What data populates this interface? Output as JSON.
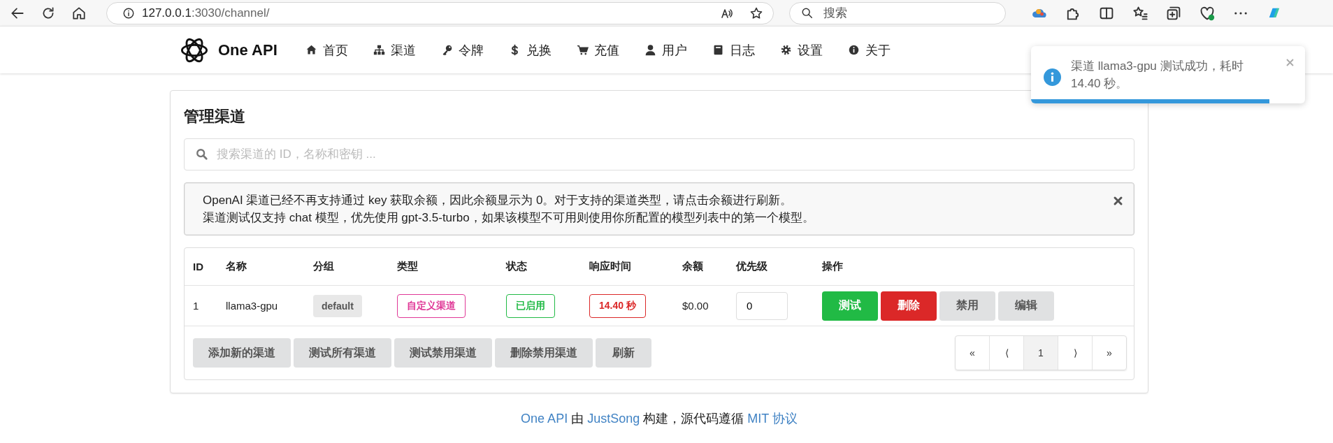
{
  "browser": {
    "url_host": "127.0.0.1",
    "url_path": ":3030/channel/",
    "search_placeholder": "搜索"
  },
  "nav": {
    "brand": "One API",
    "items": [
      {
        "label": "首页"
      },
      {
        "label": "渠道"
      },
      {
        "label": "令牌"
      },
      {
        "label": "兑换"
      },
      {
        "label": "充值"
      },
      {
        "label": "用户"
      },
      {
        "label": "日志"
      },
      {
        "label": "设置"
      },
      {
        "label": "关于"
      }
    ]
  },
  "title": "管理渠道",
  "search": {
    "placeholder": "搜索渠道的 ID，名称和密钥 ..."
  },
  "alert": {
    "lines": [
      "OpenAI 渠道已经不再支持通过 key 获取余额，因此余额显示为 0。对于支持的渠道类型，请点击余额进行刷新。",
      "渠道测试仅支持 chat 模型，优先使用 gpt-3.5-turbo，如果该模型不可用则使用你所配置的模型列表中的第一个模型。"
    ]
  },
  "table": {
    "columns": [
      "ID",
      "名称",
      "分组",
      "类型",
      "状态",
      "响应时间",
      "余额",
      "优先级",
      "操作"
    ],
    "rows": [
      {
        "id": "1",
        "name": "llama3-gpu",
        "group": "default",
        "type": {
          "label": "自定义渠道",
          "color": "#e03997"
        },
        "status": {
          "label": "已启用",
          "color": "#21ba45"
        },
        "response_time": {
          "label": "14.40 秒",
          "color": "#db2828"
        },
        "balance": "$0.00",
        "priority": "0",
        "actions": [
          {
            "label": "测试",
            "kind": "success"
          },
          {
            "label": "删除",
            "kind": "danger"
          },
          {
            "label": "禁用",
            "kind": "basic"
          },
          {
            "label": "编辑",
            "kind": "basic"
          }
        ]
      }
    ]
  },
  "footer_buttons": [
    "添加新的渠道",
    "测试所有渠道",
    "测试禁用渠道",
    "删除禁用渠道",
    "刷新"
  ],
  "pagination": [
    {
      "label": "«",
      "selected": false
    },
    {
      "label": "⟨",
      "selected": false
    },
    {
      "label": "1",
      "selected": true
    },
    {
      "label": "⟩",
      "selected": false
    },
    {
      "label": "»",
      "selected": false
    }
  ],
  "page_footer": [
    {
      "text": "One API",
      "link": true
    },
    {
      "text": " 由 ",
      "link": false
    },
    {
      "text": "JustSong",
      "link": true
    },
    {
      "text": " 构建，源代码遵循 ",
      "link": false
    },
    {
      "text": "MIT 协议",
      "link": true
    }
  ],
  "toast": {
    "message": "渠道 llama3-gpu 测试成功，耗时 14.40 秒。",
    "level": 0.87
  }
}
